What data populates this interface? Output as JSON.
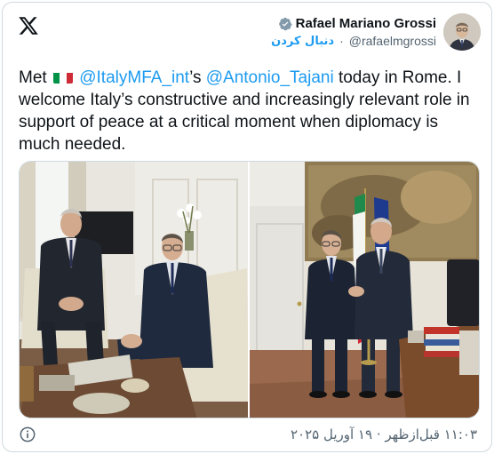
{
  "author": {
    "display_name": "Rafael Mariano Grossi",
    "handle": "@rafaelmgrossi",
    "follow_label": "دنبال کردن",
    "verified": true
  },
  "tweet": {
    "text_part1": "Met ",
    "mention1": "@ItalyMFA_int",
    "text_part2": "’s ",
    "mention2": "@Antonio_Tajani",
    "text_part3": " today in Rome. I welcome Italy’s constructive and increasingly relevant role in support of peace at a critical moment when diplomacy is much needed.",
    "flag": "Italy flag emoji"
  },
  "media": {
    "photos": [
      "meeting-seated-photo",
      "handshake-photo"
    ]
  },
  "footer": {
    "timestamp": "۱۱:۰۳ قبل‌ازظهر · ۱۹ آوریل ۲۰۲۵",
    "info_icon": "info-icon"
  },
  "colors": {
    "accent": "#1d9bf0",
    "text": "#0f1419",
    "muted": "#536471",
    "border": "#cfd9de"
  }
}
